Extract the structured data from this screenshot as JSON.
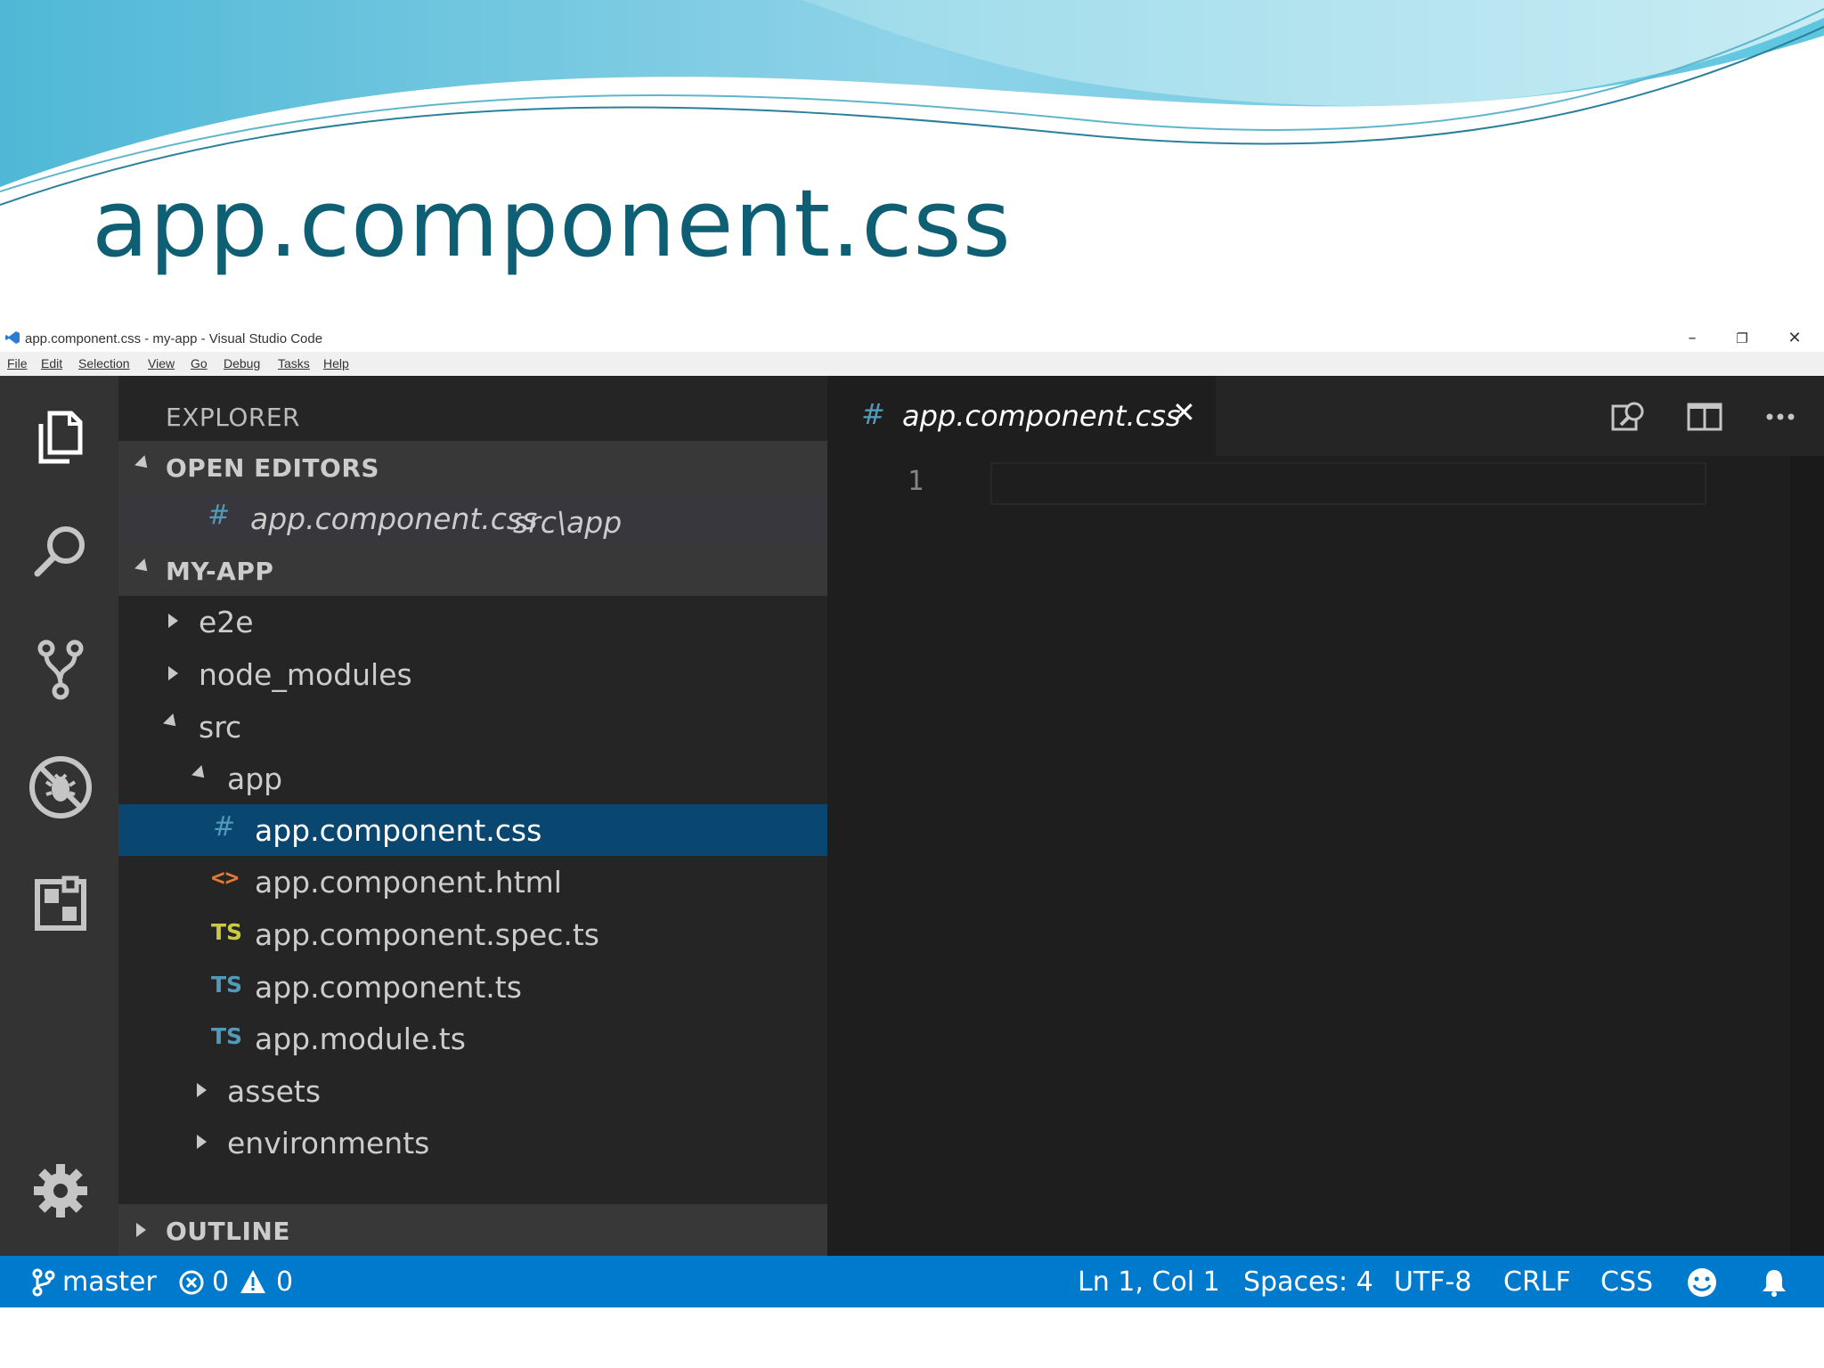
{
  "slide": {
    "title": "app.component.css",
    "accent_color": "#0f5f74"
  },
  "window": {
    "title": "app.component.css - my-app - Visual Studio Code",
    "controls": {
      "minimize": "–",
      "restore": "❐",
      "close": "✕"
    },
    "menu": [
      "File",
      "Edit",
      "Selection",
      "View",
      "Go",
      "Debug",
      "Tasks",
      "Help"
    ]
  },
  "activity_bar": {
    "icons": [
      "explorer-icon",
      "search-icon",
      "source-control-icon",
      "debug-icon",
      "extensions-icon",
      "settings-gear-icon"
    ]
  },
  "sidebar": {
    "header": "EXPLORER",
    "open_editors": {
      "label": "OPEN EDITORS",
      "items": [
        {
          "icon": "#",
          "name": "app.component.css",
          "path": "src\\app"
        }
      ]
    },
    "project": {
      "label": "MY-APP",
      "tree": [
        {
          "name": "e2e",
          "type": "folder",
          "expanded": false
        },
        {
          "name": "node_modules",
          "type": "folder",
          "expanded": false
        },
        {
          "name": "src",
          "type": "folder",
          "expanded": true
        },
        {
          "name": "app",
          "type": "folder",
          "expanded": true
        },
        {
          "name": "app.component.css",
          "type": "css",
          "icon": "#",
          "selected": true
        },
        {
          "name": "app.component.html",
          "type": "html",
          "icon": "<>"
        },
        {
          "name": "app.component.spec.ts",
          "type": "ts",
          "icon": "TS",
          "icon_color": "#cbcb41"
        },
        {
          "name": "app.component.ts",
          "type": "ts",
          "icon": "TS",
          "icon_color": "#519aba"
        },
        {
          "name": "app.module.ts",
          "type": "ts",
          "icon": "TS",
          "icon_color": "#519aba"
        },
        {
          "name": "assets",
          "type": "folder",
          "expanded": false
        },
        {
          "name": "environments",
          "type": "folder",
          "expanded": false
        }
      ]
    },
    "outline": {
      "label": "OUTLINE"
    }
  },
  "editor": {
    "tab": {
      "icon": "#",
      "label": "app.component.css",
      "close": "✕"
    },
    "actions": [
      "open-preview-icon",
      "split-editor-icon",
      "more-actions-icon"
    ],
    "line_numbers": [
      "1"
    ]
  },
  "status_bar": {
    "branch": "master",
    "errors": "0",
    "warnings": "0",
    "position": "Ln 1, Col 1",
    "spaces": "Spaces: 4",
    "encoding": "UTF-8",
    "eol": "CRLF",
    "language": "CSS",
    "color": "#007acc"
  }
}
